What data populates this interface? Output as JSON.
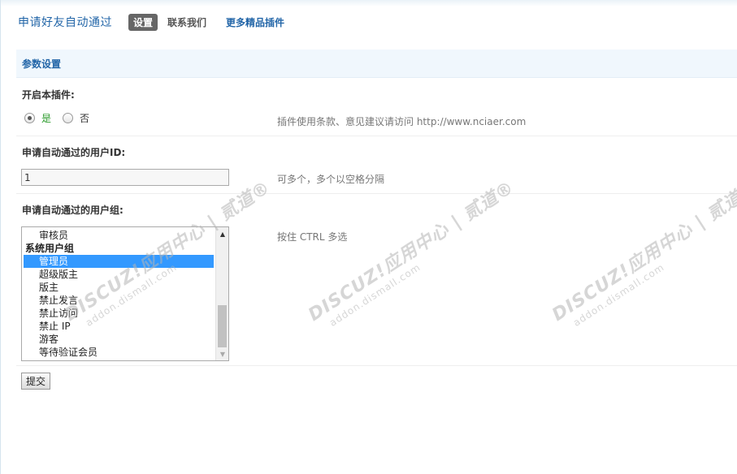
{
  "header": {
    "plugin_title": "申请好友自动通过",
    "tabs": [
      {
        "label": "设置",
        "active": true
      },
      {
        "label": "联系我们",
        "active": false
      },
      {
        "label": "更多精品插件",
        "active": false
      }
    ]
  },
  "section": {
    "title": "参数设置"
  },
  "enable": {
    "label": "开启本插件:",
    "options": [
      {
        "label": "是",
        "checked": true
      },
      {
        "label": "否",
        "checked": false
      }
    ],
    "hint": "插件使用条款、意见建议请访问 http://www.nciaer.com"
  },
  "user_id": {
    "label": "申请自动通过的用户ID:",
    "value": "1",
    "hint": "可多个，多个以空格分隔"
  },
  "user_group": {
    "label": "申请自动通过的用户组:",
    "hint": "按住 CTRL 多选",
    "items": [
      {
        "label": "审核员",
        "group": false,
        "selected": false
      },
      {
        "label": "系统用户组",
        "group": true,
        "selected": false
      },
      {
        "label": "管理员",
        "group": false,
        "selected": true
      },
      {
        "label": "超级版主",
        "group": false,
        "selected": false
      },
      {
        "label": "版主",
        "group": false,
        "selected": false
      },
      {
        "label": "禁止发言",
        "group": false,
        "selected": false
      },
      {
        "label": "禁止访问",
        "group": false,
        "selected": false
      },
      {
        "label": "禁止 IP",
        "group": false,
        "selected": false
      },
      {
        "label": "游客",
        "group": false,
        "selected": false
      },
      {
        "label": "等待验证会员",
        "group": false,
        "selected": false
      }
    ]
  },
  "submit_label": "提交",
  "watermark": {
    "line1": "DISCUZ!应用中心 | 贰道®",
    "line2": "addon.dismall.com"
  },
  "colors": {
    "accent": "#2366a8",
    "selected": "#3399ff",
    "yes": "#2a9a2a"
  }
}
